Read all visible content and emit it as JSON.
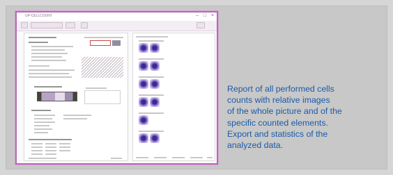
{
  "window": {
    "app_title": "UP-CELLCOUNT",
    "controls": [
      "–",
      "□",
      "×"
    ]
  },
  "toolbar": {
    "buttons": [
      "",
      "",
      "",
      ""
    ]
  },
  "caption": {
    "lines": [
      "Report of all performed cells",
      "counts with relative images",
      "of the whole picture and of the",
      "specific counted elements.",
      "Export and statistics of the",
      "analyzed data."
    ]
  },
  "colors": {
    "background": "#d6d6d6",
    "window_border": "#b66ab6",
    "caption_text": "#1a5aa8",
    "cell_stain": "#3b2a8e"
  }
}
